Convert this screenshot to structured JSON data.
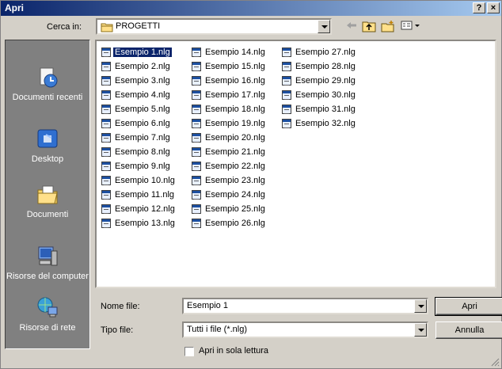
{
  "window": {
    "title": "Apri",
    "help_glyph": "?",
    "close_glyph": "×"
  },
  "toolbar": {
    "lookin_label": "Cerca in:",
    "lookin_value": "PROGETTI",
    "back_icon": "back-arrow-icon",
    "up_icon": "up-folder-icon",
    "newfolder_icon": "new-folder-icon",
    "views_icon": "view-menu-icon"
  },
  "places": [
    {
      "label": "Documenti recenti",
      "icon": "recent-documents-icon"
    },
    {
      "label": "Desktop",
      "icon": "desktop-icon"
    },
    {
      "label": "Documenti",
      "icon": "documents-icon"
    },
    {
      "label": "Risorse del computer",
      "icon": "my-computer-icon"
    },
    {
      "label": "Risorse di rete",
      "icon": "network-icon"
    }
  ],
  "files": {
    "col1": [
      "Esempio 1.nlg",
      "Esempio 2.nlg",
      "Esempio 3.nlg",
      "Esempio 4.nlg",
      "Esempio 5.nlg",
      "Esempio 6.nlg",
      "Esempio 7.nlg",
      "Esempio 8.nlg",
      "Esempio 9.nlg",
      "Esempio 10.nlg",
      "Esempio 11.nlg",
      "Esempio 12.nlg",
      "Esempio 13.nlg"
    ],
    "col2": [
      "Esempio 14.nlg",
      "Esempio 15.nlg",
      "Esempio 16.nlg",
      "Esempio 17.nlg",
      "Esempio 18.nlg",
      "Esempio 19.nlg",
      "Esempio 20.nlg",
      "Esempio 21.nlg",
      "Esempio 22.nlg",
      "Esempio 23.nlg",
      "Esempio 24.nlg",
      "Esempio 25.nlg",
      "Esempio 26.nlg"
    ],
    "col3": [
      "Esempio 27.nlg",
      "Esempio 28.nlg",
      "Esempio 29.nlg",
      "Esempio 30.nlg",
      "Esempio 31.nlg",
      "Esempio 32.nlg"
    ],
    "selected": "Esempio 1.nlg"
  },
  "filename": {
    "label": "Nome file:",
    "value": "Esempio 1"
  },
  "filetype": {
    "label": "Tipo file:",
    "value": "Tutti i file (*.nlg)"
  },
  "buttons": {
    "open": "Apri",
    "cancel": "Annulla"
  },
  "readonly": {
    "label": "Apri in sola lettura",
    "checked": false
  },
  "colors": {
    "title_start": "#0a246a",
    "title_end": "#a6caf0",
    "face": "#d4d0c8",
    "places_bg": "#808080",
    "selection": "#0a246a"
  }
}
